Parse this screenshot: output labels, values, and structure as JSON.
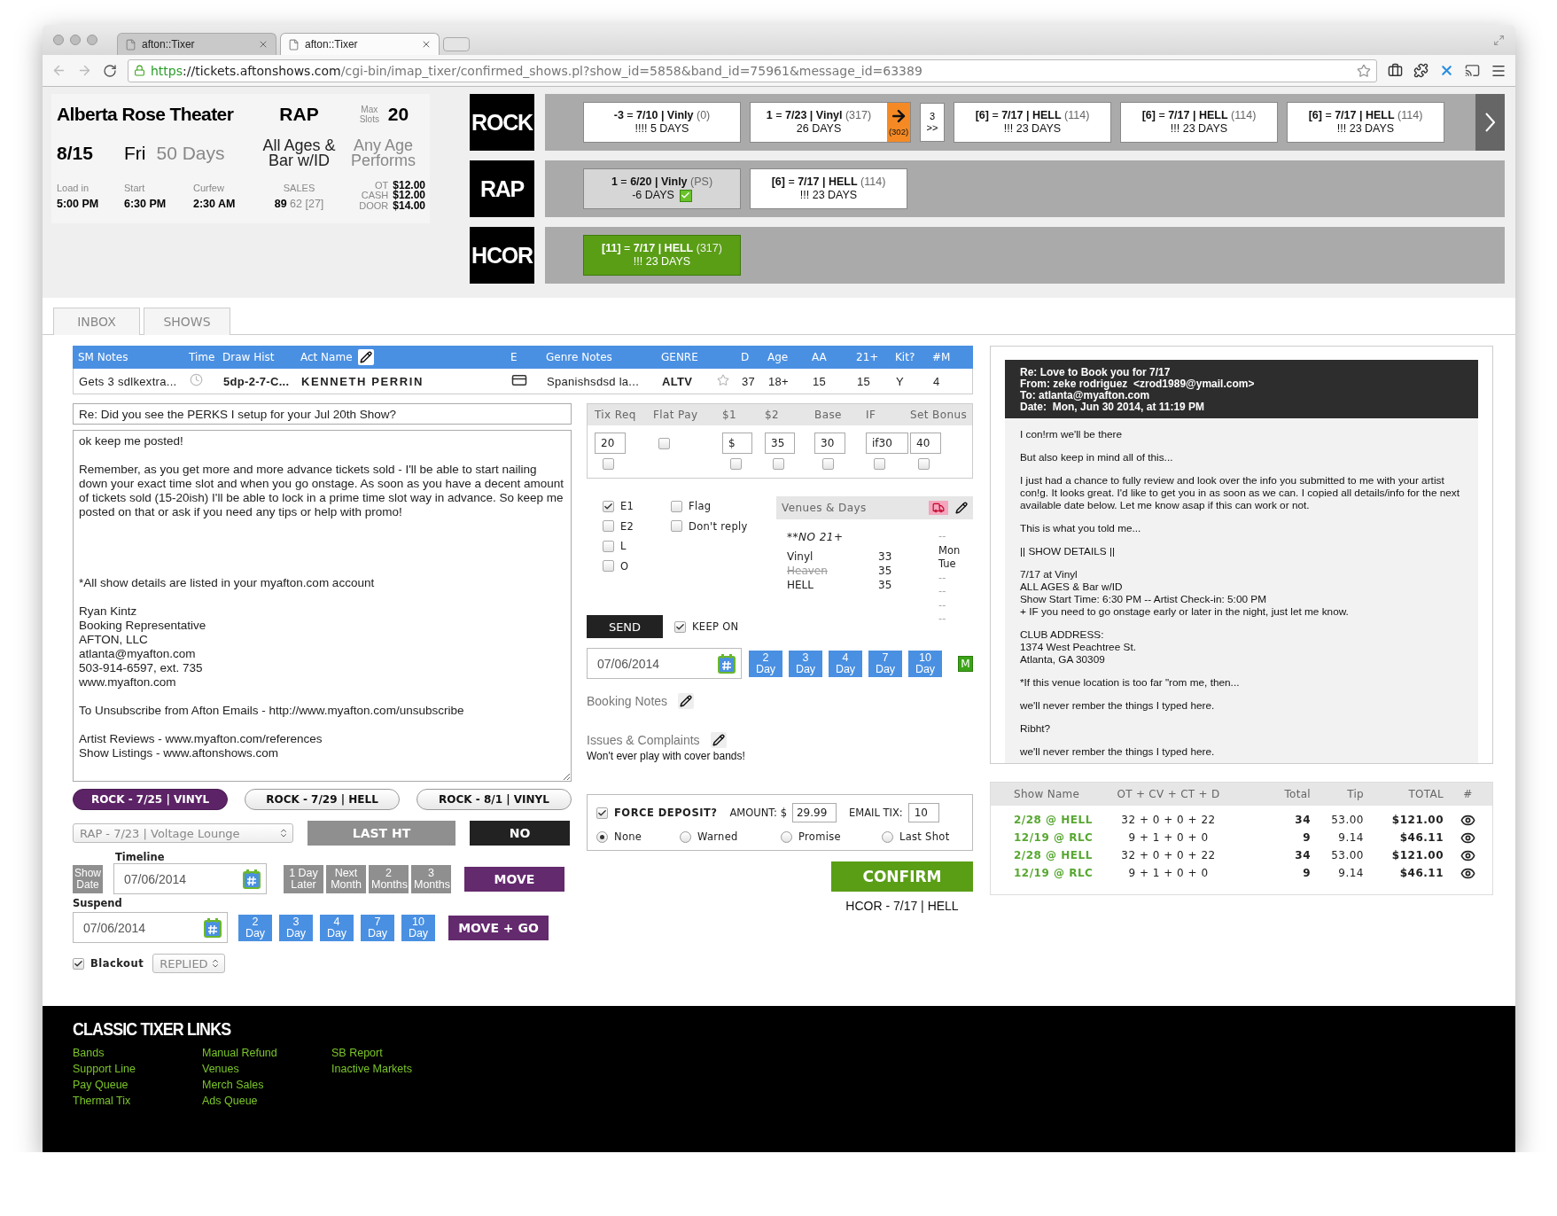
{
  "browser": {
    "tabs": [
      {
        "title": "afton::Tixer",
        "selected": false
      },
      {
        "title": "afton::Tixer",
        "selected": true
      }
    ],
    "url": {
      "scheme": "https",
      "host": "://tickets.aftonshows.com",
      "path": "/cgi-bin/imap_tixer/confirmed_shows.pl?show_id=5858&band_id=75961&message_id=63389"
    }
  },
  "venue": {
    "name": "Alberta Rose Theater",
    "genre": "RAP",
    "max_slots_label": "Max Slots",
    "max_slots": "20",
    "date": "8/15",
    "weekday": "Fri",
    "days_out": "50 Days",
    "ages": "All Ages & Bar w/ID",
    "performs": "Any Age Performs",
    "times": [
      {
        "label": "Load in",
        "value": "5:00 PM"
      },
      {
        "label": "Start",
        "value": "6:30 PM"
      },
      {
        "label": "Curfew",
        "value": "2:30 AM"
      }
    ],
    "sales_label": "SALES",
    "sales": "89",
    "sales_detail": "62 [27]",
    "prices": [
      {
        "label": "OT",
        "value": "$12.00"
      },
      {
        "label": "CASH",
        "value": "$12.00"
      },
      {
        "label": "DOOR",
        "value": "$14.00"
      }
    ]
  },
  "genre_rows": [
    {
      "genre": "ROCK",
      "has_next": true,
      "slots": [
        {
          "kind": "open",
          "title": "**-3** = **7/10 | Vinly**",
          "count": "(0)",
          "days": "!!!! 5 DAYS",
          "confirmed": false
        },
        {
          "kind": "open",
          "title": "**1** = **7/23 | Vinyl**",
          "count": "(317)",
          "days": "26 DAYS",
          "confirmed": false,
          "move_count": "(302)"
        },
        {
          "kind": "more",
          "label": "3 >>"
        },
        {
          "kind": "open",
          "title": "**[6]** = **7/17 | HELL**",
          "count": "(114)",
          "days": "!!! 23 DAYS",
          "confirmed": false
        },
        {
          "kind": "open",
          "title": "**[6]** = **7/17 | HELL**",
          "count": "(114)",
          "days": "!!! 23 DAYS",
          "confirmed": false
        },
        {
          "kind": "open",
          "title": "**[6]** = **7/17 | HELL**",
          "count": "(114)",
          "days": "!!! 23 DAYS",
          "confirmed": false
        }
      ]
    },
    {
      "genre": "RAP",
      "has_next": false,
      "slots": [
        {
          "kind": "past",
          "title": "**1** = **6/20 | Vinly**",
          "count": "(PS)",
          "days": "-6 DAYS",
          "confirmed": true
        },
        {
          "kind": "open",
          "title": "**[6]** = **7/17 | HELL**",
          "count": "(114)",
          "days": "!!! 23 DAYS",
          "confirmed": false
        }
      ]
    },
    {
      "genre": "HCOR",
      "has_next": false,
      "slots": [
        {
          "kind": "booked",
          "title": "**[11]** = **7/17 | HELL**",
          "count": "(317)",
          "days": "!!! 23 DAYS",
          "confirmed": false
        }
      ]
    }
  ],
  "page_tabs": [
    {
      "label": "INBOX",
      "selected": false
    },
    {
      "label": "SHOWS",
      "selected": false
    }
  ],
  "act_table": {
    "columns": [
      "SM Notes",
      "Time",
      "Draw Hist",
      "Act Name",
      "E",
      "Genre Notes",
      "GENRE",
      "D",
      "Age",
      "AA",
      "21+",
      "Kit?",
      "#M"
    ],
    "row": {
      "sm_notes": "Gets 3 sdlkextra...",
      "draw_hist": "5dp-2-7-C...",
      "act_name": "KENNETH PERRIN",
      "genre_notes": "Spanishsdsd la...",
      "genre": "ALTV",
      "starred": false,
      "d": "37",
      "age": "18+",
      "aa": "15",
      "over21": "15",
      "kit": "Y",
      "m": "4"
    }
  },
  "subject": "Re: Did you see the PERKS I setup for your Jul 20th Show?",
  "message": "ok keep me posted!\n\nRemember, as you get more and more advance tickets sold - I'll be able to start nailing down your exact time slot and when you go onstage. As soon as you have a decent amount of tickets sold (15-20ish) I'll be able to lock in a prime time slot way in advance. So keep me posted on that or ask if you need any tips or help with promo!\n\n\n\n\n*All show details are listed in your myafton.com account\n\nRyan Kintz\nBooking Representative\nAFTON, LLC\natlanta@myafton.com\n503-914-6597, ext. 735\nwww.myafton.com\n\nTo Unsubscribe from Afton Emails - http://www.myafton.com/unsubscribe\n\nArtist Reviews - www.myafton.com/references\nShow Listings - www.aftonshows.com",
  "show_buttons": [
    {
      "label": "ROCK - 7/25 | VINYL",
      "selected": true
    },
    {
      "label": "ROCK - 7/29 | HELL",
      "selected": false
    },
    {
      "label": "ROCK - 8/1 | VINYL",
      "selected": false
    }
  ],
  "show_select": "RAP - 7/23 | Voltage Lounge",
  "last_ht": "LAST HT",
  "no": "NO",
  "timeline": {
    "label": "Timeline",
    "show_date": "Show Date",
    "date": "07/06/2014",
    "quick": [
      "1 Day Later",
      "Next Month",
      "2 Months",
      "3 Months"
    ],
    "action": "MOVE"
  },
  "suspend": {
    "label": "Suspend",
    "date": "07/06/2014",
    "days": [
      "2 Day",
      "3 Day",
      "4 Day",
      "7 Day",
      "10 Day"
    ],
    "action": "MOVE + GO"
  },
  "blackout": {
    "label": "Blackout",
    "checked": true,
    "status": "REPLIED"
  },
  "pay": {
    "columns": [
      "Tix Req",
      "Flat Pay",
      "$1",
      "$2",
      "Base",
      "IF",
      "Set Bonus"
    ],
    "fields": [
      {
        "kind": "input",
        "value": "20",
        "checked": false
      },
      {
        "kind": "checkbox",
        "checked": false
      },
      {
        "kind": "input",
        "value": "$",
        "checked": false
      },
      {
        "kind": "input",
        "value": "35",
        "checked": false
      },
      {
        "kind": "input",
        "value": "30",
        "checked": false
      },
      {
        "kind": "input",
        "value": "if30",
        "checked": false
      },
      {
        "kind": "input",
        "value": "40",
        "checked": false
      }
    ]
  },
  "flags_left": [
    {
      "label": "E1",
      "checked": true
    },
    {
      "label": "E2",
      "checked": false
    },
    {
      "label": "L",
      "checked": false
    },
    {
      "label": "O",
      "checked": false
    }
  ],
  "flags_right": [
    {
      "label": "Flag",
      "checked": false
    },
    {
      "label": "Don't reply",
      "checked": false
    }
  ],
  "venues": {
    "title": "Venues & Days",
    "note": "**NO 21+",
    "list": [
      {
        "name": "Vinyl",
        "count": "33",
        "struck": false
      },
      {
        "name": "Heaven",
        "count": "35",
        "struck": true
      },
      {
        "name": "HELL",
        "count": "35",
        "struck": false
      }
    ],
    "days": [
      "--",
      "Mon",
      "Tue",
      "--",
      "--",
      "--",
      "--"
    ]
  },
  "send": "SEND",
  "keep_on": {
    "label": "KEEP ON",
    "checked": true
  },
  "booking_date": "07/06/2014",
  "booking_days": [
    "2 Day",
    "3 Day",
    "4 Day",
    "7 Day",
    "10 Day"
  ],
  "m_button": "M",
  "booking_notes": "Booking Notes",
  "issues": "Issues & Complaints",
  "complaint": "Won't ever play with cover bands!",
  "deposit": {
    "label": "FORCE DEPOSIT?",
    "checked": true,
    "amount_label": "AMOUNT: $",
    "amount": "29.99",
    "tix_label": "EMAIL TIX:",
    "tix": "10",
    "options": [
      {
        "label": "None",
        "selected": true
      },
      {
        "label": "Warned",
        "selected": false
      },
      {
        "label": "Promise",
        "selected": false
      },
      {
        "label": "Last Shot",
        "selected": false
      }
    ]
  },
  "confirm": "CONFIRM",
  "confirm_caption": "HCOR - 7/17 | HELL",
  "email": {
    "header": [
      "Re: Love to Book you for 7/17",
      "From: zeke rodriguez  <zrod1989@ymail.com>",
      "To: atlanta@myafton.com",
      "Date:  Mon, Jun 30 2014, at 11:19 PM"
    ],
    "body": [
      "I con!rm we'll be there",
      "But also keep in mind all of this...",
      "I just had a chance to fully review and look over the info you submitted to me with your artist con!g. It looks great. I'd like to get you in as soon as we can. I copied all details/info for the next available date below. Let me know asap if this can work or not.",
      "This is what you told me...",
      "|| SHOW DETAILS ||",
      "7/17 at Vinyl\nALL AGES & Bar w/ID\nShow Start Time: 6:30 PM -- Artist Check-in: 5:00 PM\n+ IF you need to go onstage early or later in the night, just let me know.",
      "CLUB ADDRESS:\n1374 West Peachtree St.\nAtlanta, GA 30309",
      "*If this venue location is too far \"rom me, then...",
      "we'll never rember the things I typed here.",
      "Ribht?",
      "we'll never rember the things I typed here."
    ]
  },
  "sales": {
    "columns": [
      "Show Name",
      "OT + CV + CT + D",
      "Total",
      "Tip",
      "TOTAL",
      "#"
    ],
    "rows": [
      {
        "show": "2/28 @ HELL",
        "formula": "32 + 0 + 0 + 22",
        "total": "34",
        "tip": "53.00",
        "grand": "$121.00"
      },
      {
        "show": "12/19 @ RLC",
        "formula": "9 + 1 + 0 + 0",
        "total": "9",
        "tip": "9.14",
        "grand": "$46.11"
      },
      {
        "show": "2/28 @ HELL",
        "formula": "32 + 0 + 0 + 22",
        "total": "34",
        "tip": "53.00",
        "grand": "$121.00"
      },
      {
        "show": "12/19 @ RLC",
        "formula": "9 + 1 + 0 + 0",
        "total": "9",
        "tip": "9.14",
        "grand": "$46.11"
      }
    ]
  },
  "footer": {
    "title": "CLASSIC TIXER LINKS",
    "columns": [
      [
        "Bands",
        "Support Line",
        "Pay Queue",
        "Thermal Tix"
      ],
      [
        "Manual Refund",
        "Venues",
        "Merch Sales",
        "Ads Queue"
      ],
      [
        "SB Report",
        "Inactive Markets"
      ]
    ]
  }
}
